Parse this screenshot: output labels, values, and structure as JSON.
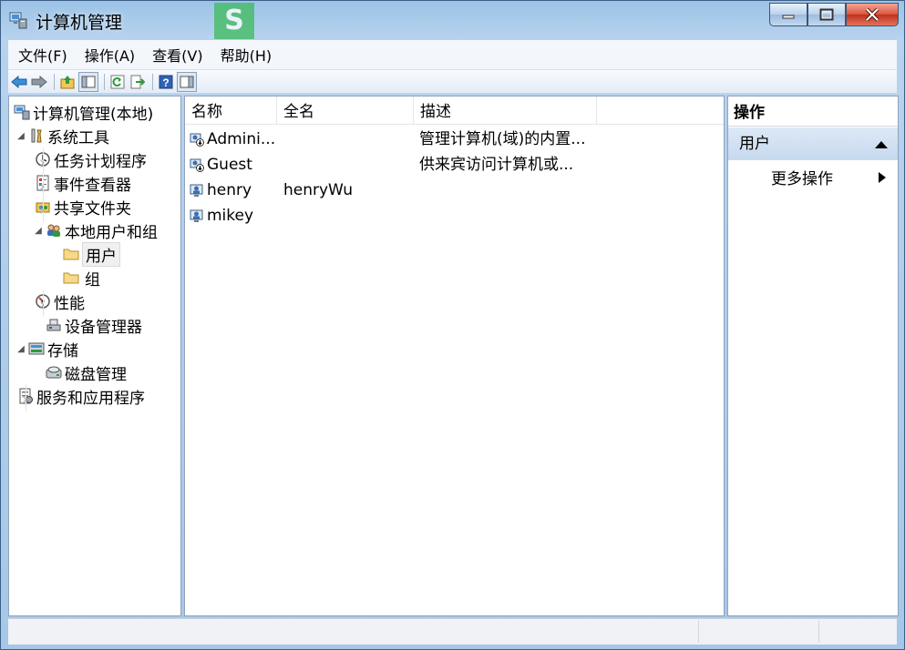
{
  "window": {
    "title": "计算机管理"
  },
  "menu": [
    "文件(F)",
    "操作(A)",
    "查看(V)",
    "帮助(H)"
  ],
  "toolbar": {
    "icons": [
      "back-icon",
      "forward-icon",
      "up-folder-icon",
      "show-hide-tree-icon",
      "refresh-icon",
      "export-icon",
      "help-icon",
      "show-hide-action-icon"
    ]
  },
  "tree": [
    {
      "label": "计算机管理(本地)",
      "level": 0,
      "arrow": "",
      "icon": "computer-management-icon"
    },
    {
      "label": "系统工具",
      "level": 1,
      "arrow": "◢",
      "icon": "tools-icon"
    },
    {
      "label": "任务计划程序",
      "level": 2,
      "arrow": "›",
      "icon": "clock-icon"
    },
    {
      "label": "事件查看器",
      "level": 2,
      "arrow": "›",
      "icon": "event-viewer-icon"
    },
    {
      "label": "共享文件夹",
      "level": 2,
      "arrow": "›",
      "icon": "shared-folder-icon"
    },
    {
      "label": "本地用户和组",
      "level": 2,
      "arrow": "◢",
      "icon": "users-groups-icon"
    },
    {
      "label": "用户",
      "level": 3,
      "arrow": "",
      "icon": "folder-icon",
      "selected": true
    },
    {
      "label": "组",
      "level": 3,
      "arrow": "",
      "icon": "folder-icon"
    },
    {
      "label": "性能",
      "level": 2,
      "arrow": "›",
      "icon": "performance-icon"
    },
    {
      "label": "设备管理器",
      "level": 2,
      "arrow": "",
      "icon": "device-manager-icon"
    },
    {
      "label": "存储",
      "level": 1,
      "arrow": "◢",
      "icon": "storage-icon"
    },
    {
      "label": "磁盘管理",
      "level": 2,
      "arrow": "",
      "icon": "disk-icon"
    },
    {
      "label": "服务和应用程序",
      "level": 1,
      "arrow": "›",
      "icon": "services-icon"
    }
  ],
  "list": {
    "columns": [
      "名称",
      "全名",
      "描述"
    ],
    "rows": [
      {
        "name": "Admini...",
        "fullname": "",
        "description": "管理计算机(域)的内置...",
        "disabled": true
      },
      {
        "name": "Guest",
        "fullname": "",
        "description": "供来宾访问计算机或...",
        "disabled": true
      },
      {
        "name": "henry",
        "fullname": "henryWu",
        "description": "",
        "disabled": false
      },
      {
        "name": "mikey",
        "fullname": "",
        "description": "",
        "disabled": false
      }
    ]
  },
  "actions": {
    "title": "操作",
    "section": "用户",
    "items": [
      "更多操作"
    ]
  },
  "colors": {
    "selection": "#f0f0f0",
    "accent": "#3a7bd5"
  }
}
